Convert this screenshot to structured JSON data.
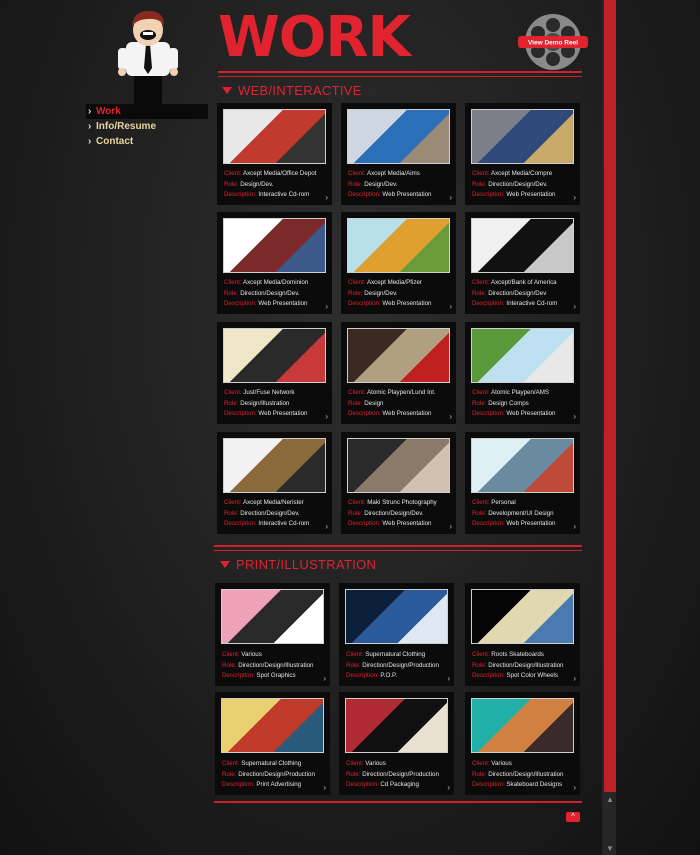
{
  "page": {
    "title": "WORK"
  },
  "reel": {
    "label": "View Demo Reel"
  },
  "nav": [
    {
      "label": "Work",
      "active": true
    },
    {
      "label": "Info/Resume",
      "active": false
    },
    {
      "label": "Contact",
      "active": false
    }
  ],
  "labels": {
    "client": "Client:",
    "role": "Role:",
    "description": "Description:"
  },
  "sections": [
    {
      "title": "WEB/INTERACTIVE",
      "items": [
        {
          "client": "Axcept Media/Office Depot",
          "role": "Design/Dev.",
          "description": "Interactive Cd-rom",
          "thumb": [
            "#e8e8e8",
            "#c23a2e",
            "#333333"
          ]
        },
        {
          "client": "Axcept Media/Aims",
          "role": "Design/Dev.",
          "description": "Web Presentation",
          "thumb": [
            "#cfd8e2",
            "#2a6fb8",
            "#9a8b76"
          ]
        },
        {
          "client": "Axcept Media/Compre",
          "role": "Direction/Design/Dev.",
          "description": "Web Presentation",
          "thumb": [
            "#7a7f87",
            "#2d4a7a",
            "#c9a96a"
          ]
        },
        {
          "client": "Axcept Media/Dominion",
          "role": "Direction/Design/Dev.",
          "description": "Web Presentation",
          "thumb": [
            "#ffffff",
            "#7a2a2a",
            "#3b5a8a"
          ]
        },
        {
          "client": "Axcept Media/Pfizer",
          "role": "Design/Dev.",
          "description": "Web Presentation",
          "thumb": [
            "#b7e0e8",
            "#e0a030",
            "#6a9a3a"
          ]
        },
        {
          "client": "Axcept/Bank of America",
          "role": "Direction/Design/Dev",
          "description": "Interactive Cd-rom",
          "thumb": [
            "#f0f0f0",
            "#111111",
            "#c8c8c8"
          ]
        },
        {
          "client": "Just/Fuse Network",
          "role": "Design/Illustration",
          "description": "Web Presentation",
          "thumb": [
            "#efe7c8",
            "#2a2a2a",
            "#c83a3a"
          ]
        },
        {
          "client": "Atomic Playpen/Lund Int.",
          "role": "Design",
          "description": "Web Presentation",
          "thumb": [
            "#3a2a22",
            "#b0a080",
            "#c02020"
          ]
        },
        {
          "client": "Atomic Playpen/AMS",
          "role": "Design Comps",
          "description": "Web Presentation",
          "thumb": [
            "#5a9a3a",
            "#bfe0f0",
            "#e8e8e8"
          ]
        },
        {
          "client": "Axcept Media/Nerister",
          "role": "Direction/Design/Dev.",
          "description": "Interactive Cd-rom",
          "thumb": [
            "#f2f2f2",
            "#8a6a3a",
            "#2a2a2a"
          ]
        },
        {
          "client": "Maki Strunc Photography",
          "role": "Direction/Design/Dev.",
          "description": "Web Presentation",
          "thumb": [
            "#2a2a2a",
            "#8a7a6a",
            "#d0c0b0"
          ]
        },
        {
          "client": "Personal",
          "role": "Development/UI Design",
          "description": "Web Presentation",
          "thumb": [
            "#dff0f5",
            "#6a8aa0",
            "#c04a3a"
          ]
        }
      ]
    },
    {
      "title": "PRINT/ILLUSTRATION",
      "items": [
        {
          "client": "Various",
          "role": "Direction/Design/Illustration",
          "description": "Spot Graphics",
          "thumb": [
            "#f0a0b8",
            "#2a2a2a",
            "#ffffff"
          ]
        },
        {
          "client": "Supernatural Clothing",
          "role": "Direction/Design/Production",
          "description": "P.O.P.",
          "thumb": [
            "#0d1f3a",
            "#2a5a9a",
            "#dfe8f0"
          ]
        },
        {
          "client": "Roots Skateboards",
          "role": "Direction/Design/Illustration",
          "description": "Spot Color Wheels",
          "thumb": [
            "#050505",
            "#e0d8b0",
            "#4a7ab0"
          ]
        },
        {
          "client": "Supernatural Clothing",
          "role": "Direction/Design/Production",
          "description": "Print Advertising",
          "thumb": [
            "#e8d070",
            "#c03a2a",
            "#2a5a7a"
          ]
        },
        {
          "client": "Various",
          "role": "Direction/Design/Production",
          "description": "Cd Packaging",
          "thumb": [
            "#b02a34",
            "#111111",
            "#e8e0d0"
          ]
        },
        {
          "client": "Various",
          "role": "Direction/Design/Illustration",
          "description": "Skateboard Designs",
          "thumb": [
            "#20b0a8",
            "#d08040",
            "#3a2a2a"
          ]
        }
      ]
    }
  ],
  "scroll_top": {
    "label": "^"
  }
}
